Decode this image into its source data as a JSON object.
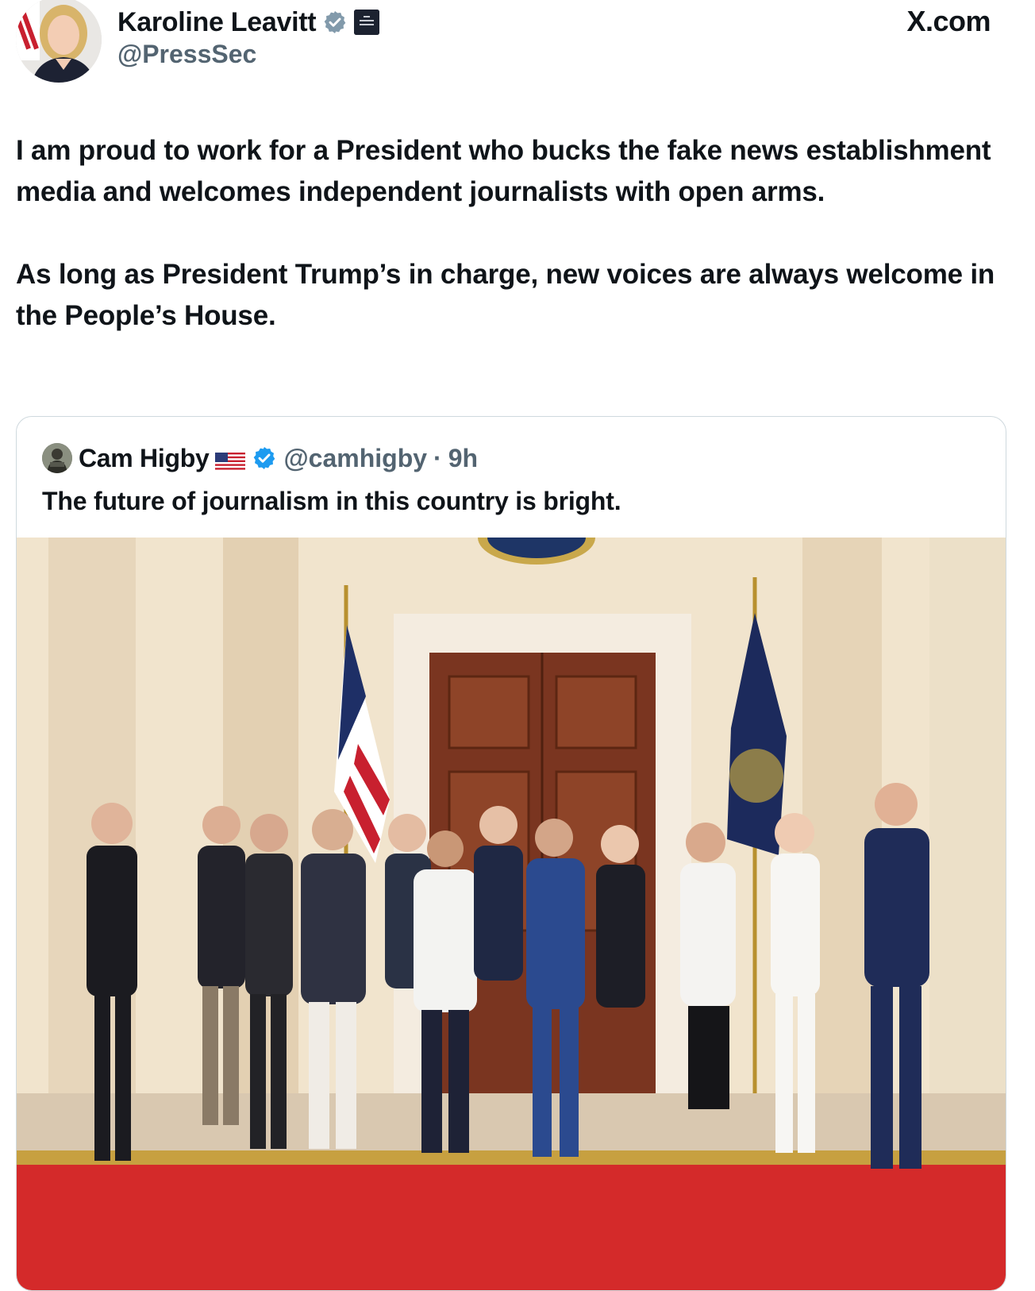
{
  "post": {
    "author": {
      "name": "Karoline Leavitt",
      "handle": "@PressSec",
      "verified": true,
      "verified_badge_color": "#829aab",
      "affiliation_badge_text": "The WHITE HOUSE"
    },
    "source_label": "X.com",
    "text_paragraphs": [
      "I am proud to work for a President who bucks the fake news establishment media and welcomes independent journalists with open arms.",
      "As long as President Trump’s in charge, new voices are always welcome in the People’s House."
    ]
  },
  "quote": {
    "author": {
      "name": "Cam Higby",
      "flag": "🇺🇸",
      "verified": true,
      "verified_badge_color": "#1d9bf0",
      "handle": "@camhigby",
      "separator": "·",
      "time": "9h"
    },
    "text": "The future of journalism in this country is bright.",
    "image": {
      "subject": "group-photo",
      "people_count": 12
    }
  },
  "colors": {
    "text_primary": "#0f1419",
    "text_secondary": "#536471",
    "border": "#cfd9de",
    "carpet": "#d42a2a",
    "door": "#7a3520",
    "wall": "#f1e4cd"
  },
  "icons": {
    "verified": "verified-badge-icon",
    "affiliation": "white-house-badge-icon",
    "flag": "us-flag-icon"
  }
}
